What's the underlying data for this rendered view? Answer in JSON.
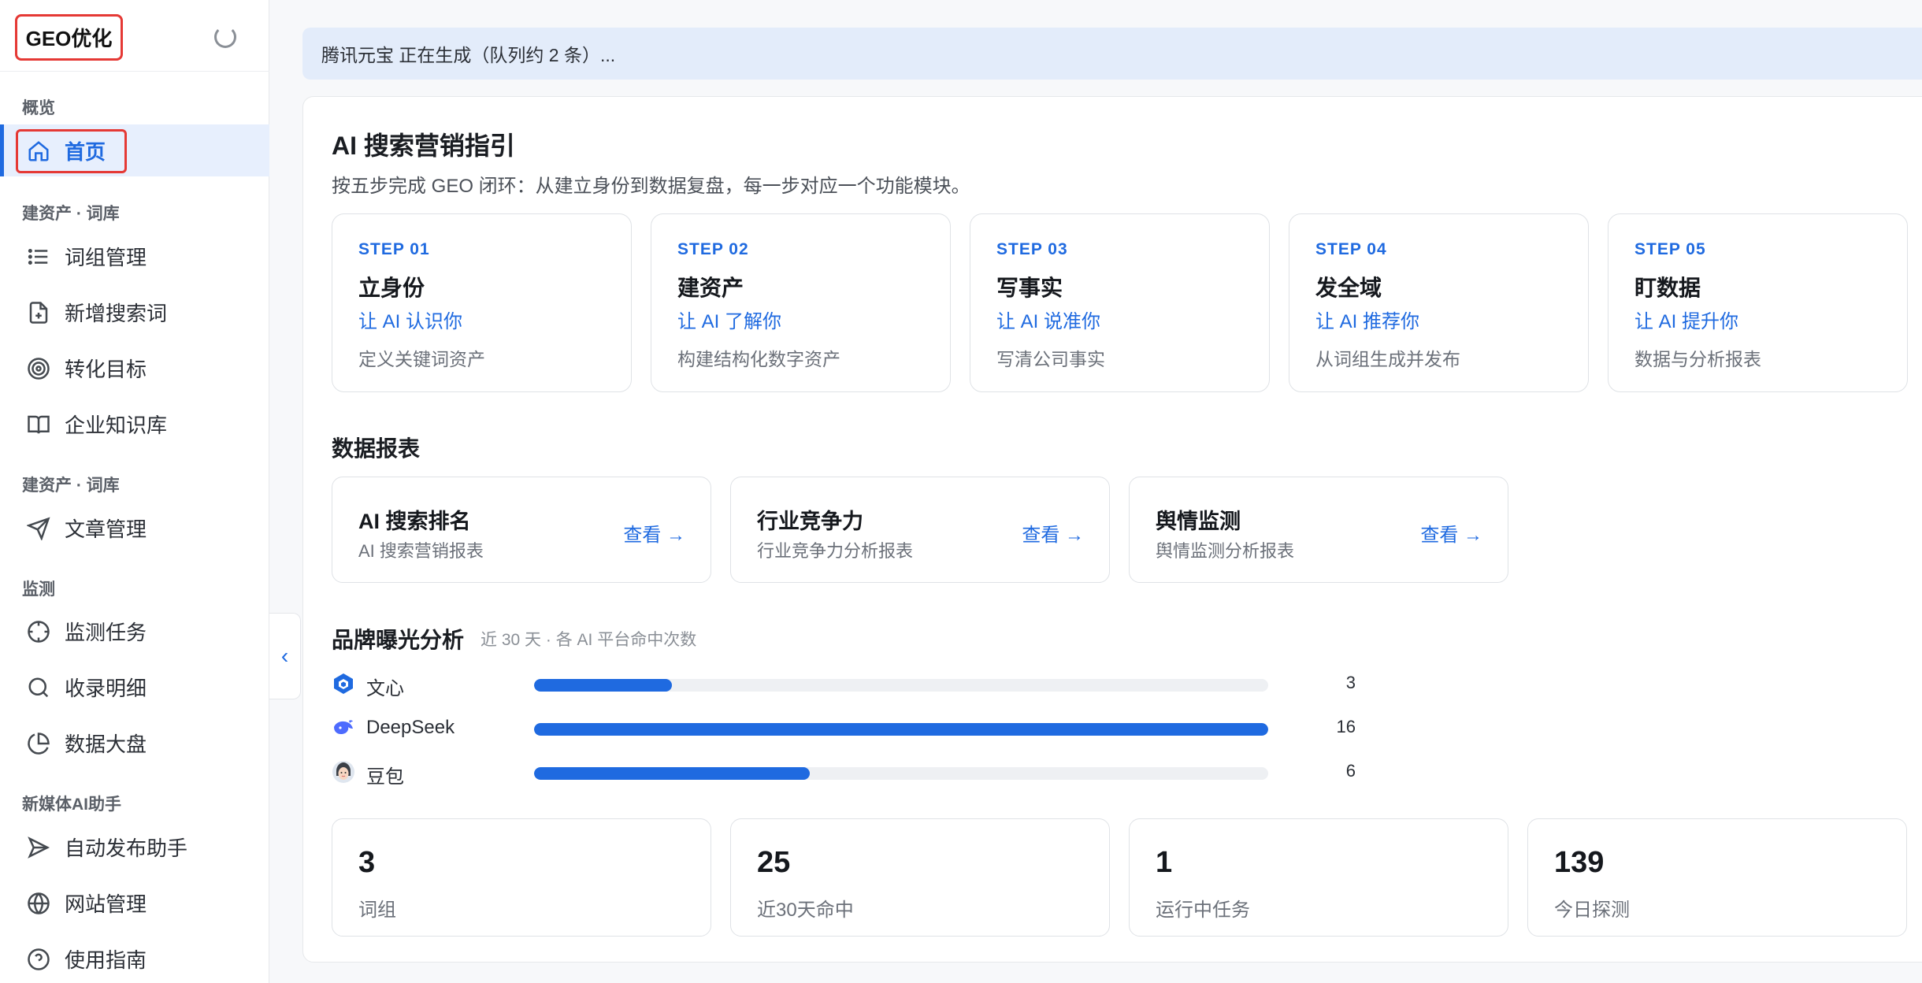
{
  "sidebar": {
    "logo": "GEO优化",
    "sections": [
      {
        "title": "概览"
      },
      {
        "title": "建资产 · 词库"
      },
      {
        "title": "建资产 · 词库"
      },
      {
        "title": "监测"
      },
      {
        "title": "新媒体AI助手"
      }
    ],
    "items": [
      {
        "label": "首页",
        "icon": "home-icon"
      },
      {
        "label": "词组管理",
        "icon": "list-icon"
      },
      {
        "label": "新增搜索词",
        "icon": "file-plus-icon"
      },
      {
        "label": "转化目标",
        "icon": "target-icon"
      },
      {
        "label": "企业知识库",
        "icon": "book-icon"
      },
      {
        "label": "文章管理",
        "icon": "send-icon"
      },
      {
        "label": "监测任务",
        "icon": "crosshair-icon"
      },
      {
        "label": "收录明细",
        "icon": "search-icon"
      },
      {
        "label": "数据大盘",
        "icon": "pie-chart-icon"
      },
      {
        "label": "自动发布助手",
        "icon": "send-icon"
      },
      {
        "label": "网站管理",
        "icon": "globe-icon"
      },
      {
        "label": "使用指南",
        "icon": "help-icon"
      }
    ],
    "collapse_icon": "‹"
  },
  "banner": {
    "text": "腾讯元宝 正在生成（队列约 2 条）..."
  },
  "guide": {
    "title": "AI 搜索营销指引",
    "subtitle": "按五步完成 GEO 闭环：从建立身份到数据复盘，每一步对应一个功能模块。",
    "steps": [
      {
        "id": "STEP 01",
        "title": "立身份",
        "tag": "让 AI 认识你",
        "desc": "定义关键词资产"
      },
      {
        "id": "STEP 02",
        "title": "建资产",
        "tag": "让 AI 了解你",
        "desc": "构建结构化数字资产"
      },
      {
        "id": "STEP 03",
        "title": "写事实",
        "tag": "让 AI 说准你",
        "desc": "写清公司事实"
      },
      {
        "id": "STEP 04",
        "title": "发全域",
        "tag": "让 AI 推荐你",
        "desc": "从词组生成并发布"
      },
      {
        "id": "STEP 05",
        "title": "盯数据",
        "tag": "让 AI 提升你",
        "desc": "数据与分析报表"
      }
    ]
  },
  "reports": {
    "title": "数据报表",
    "cards": [
      {
        "title": "AI 搜索排名",
        "desc": "AI 搜索营销报表",
        "link": "查看 →"
      },
      {
        "title": "行业竞争力",
        "desc": "行业竞争力分析报表",
        "link": "查看 →"
      },
      {
        "title": "舆情监测",
        "desc": "舆情监测分析报表",
        "link": "查看 →"
      }
    ]
  },
  "exposure": {
    "title": "品牌曝光分析",
    "note": "近 30 天 · 各 AI 平台命中次数",
    "max": 16,
    "rows": [
      {
        "name": "文心",
        "count": 3,
        "color": "#1f6ae0"
      },
      {
        "name": "DeepSeek",
        "count": 16,
        "color": "#4d6bfe"
      },
      {
        "name": "豆包",
        "count": 6,
        "color": "#f2a37a"
      }
    ]
  },
  "stats": [
    {
      "value": "3",
      "label": "词组"
    },
    {
      "value": "25",
      "label": "近30天命中"
    },
    {
      "value": "1",
      "label": "运行中任务"
    },
    {
      "value": "139",
      "label": "今日探测"
    }
  ]
}
